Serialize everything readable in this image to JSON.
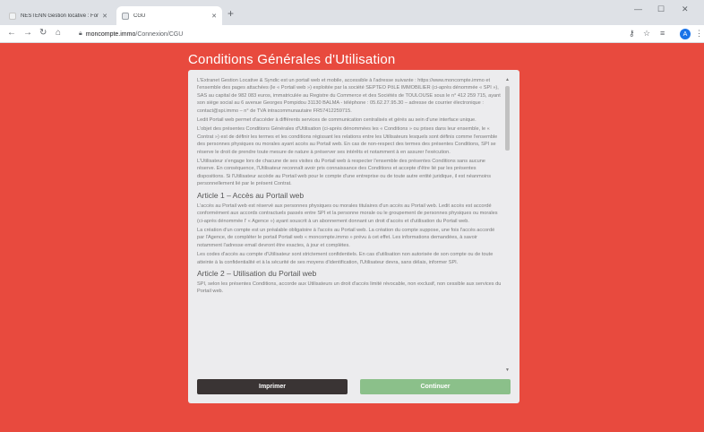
{
  "browser": {
    "tabs": [
      {
        "title": "NESTENN Gestion locative : Fonc",
        "favicon_color": "#f1f3f4"
      },
      {
        "title": "CGU",
        "favicon_color": "#e8eaed"
      }
    ],
    "url_domain": "moncompte.immo",
    "url_path": "/Connexion/CGU",
    "profile_initial": "A"
  },
  "colors": {
    "page_background": "#e84a3e",
    "card_background": "#ececee",
    "print_button": "#3a3434",
    "continue_button": "#8bc08a"
  },
  "page": {
    "title": "Conditions Générales d'Utilisation",
    "paragraphs_intro": [
      "L'Extranet Gestion Locative & Syndic est un portail web et mobile, accessible à l'adresse suivante : https://www.moncompte.immo et l'ensemble des pages attachées (le « Portail web ») exploitée par la société SEPTEO PôLE IMMOBILIER (ci-après dénommée « SPI »), SAS au capital de 982 083 euros, immatriculée au Registre du Commerce et des Sociétés de TOULOUSE sous le n° 412 259 715, ayant son siège social au 6 avenue Georges Pompidou 31130 BALMA - téléphone : 05.62.27.95.30 – adresse de courrier électronique : contact@spi.immo – n° de TVA intracommunautaire FR57412259715.",
      "Ledit Portail web permet d'accéder à différents services de communication centralisés et gérés au sein d'une interface unique.",
      "L'objet des présentes Conditions Générales d'Utilisation (ci-après dénommées les « Conditions » ou prises dans leur ensemble, le « Contrat ») est de définir les termes et les conditions régissant les relations entre les Utilisateurs lesquels sont définis comme l'ensemble des personnes physiques ou morales ayant accès au Portail web. En cas de non-respect des termes des présentes Conditions, SPI se réserve le droit de prendre toute mesure de nature à préserver ses intérêts et notamment à en assurer l'exécution.",
      "L'Utilisateur s'engage lors de chacune de ses visites du Portail web à respecter l'ensemble des présentes Conditions sans aucune réserve. En conséquence, l'Utilisateur reconnaît avoir pris connaissance des Conditions et accepte d'être lié par les présentes dispositions. Si l'Utilisateur accède au Portail web pour le compte d'une entreprise ou de toute autre entité juridique, il est néanmoins personnellement lié par le présent Contrat."
    ],
    "article1_title": "Article 1 – Accès au Portail web",
    "article1_paragraphs": [
      "L'accès au Portail web est réservé aux personnes physiques ou morales titulaires d'un accès au Portail web. Ledit accès est accordé conformément aux accords contractuels passés entre SPI et la personne morale ou le groupement de personnes physiques ou morales (ci-après dénommée l' « Agence ») ayant souscrit à un abonnement donnant un droit d'accès et d'utilisation du Portail web.",
      "La création d'un compte est un préalable obligatoire à l'accès au Portail web. La création du compte suppose, une fois l'accès accordé par l'Agence, de compléter le portail Portail web « moncompte.immo » prévu à cet effet. Les informations demandées, à savoir notamment l'adresse email devront être exactes, à jour et complètes.",
      "Les codes d'accès au compte d'Utilisateur sont strictement confidentiels. En cas d'utilisation non autorisée de son compte ou de toute atteinte à la confidentialité et à la sécurité de ses moyens d'identification, l'Utilisateur devra, sans délais, informer SPI."
    ],
    "article2_title": "Article 2 – Utilisation du Portail web",
    "article2_paragraphs": [
      "SPI, selon les présentes Conditions, accorde aux Utilisateurs un droit d'accès limité révocable, non exclusif, non cessible aux services du Portail web."
    ],
    "print_label": "Imprimer",
    "continue_label": "Continuer"
  }
}
